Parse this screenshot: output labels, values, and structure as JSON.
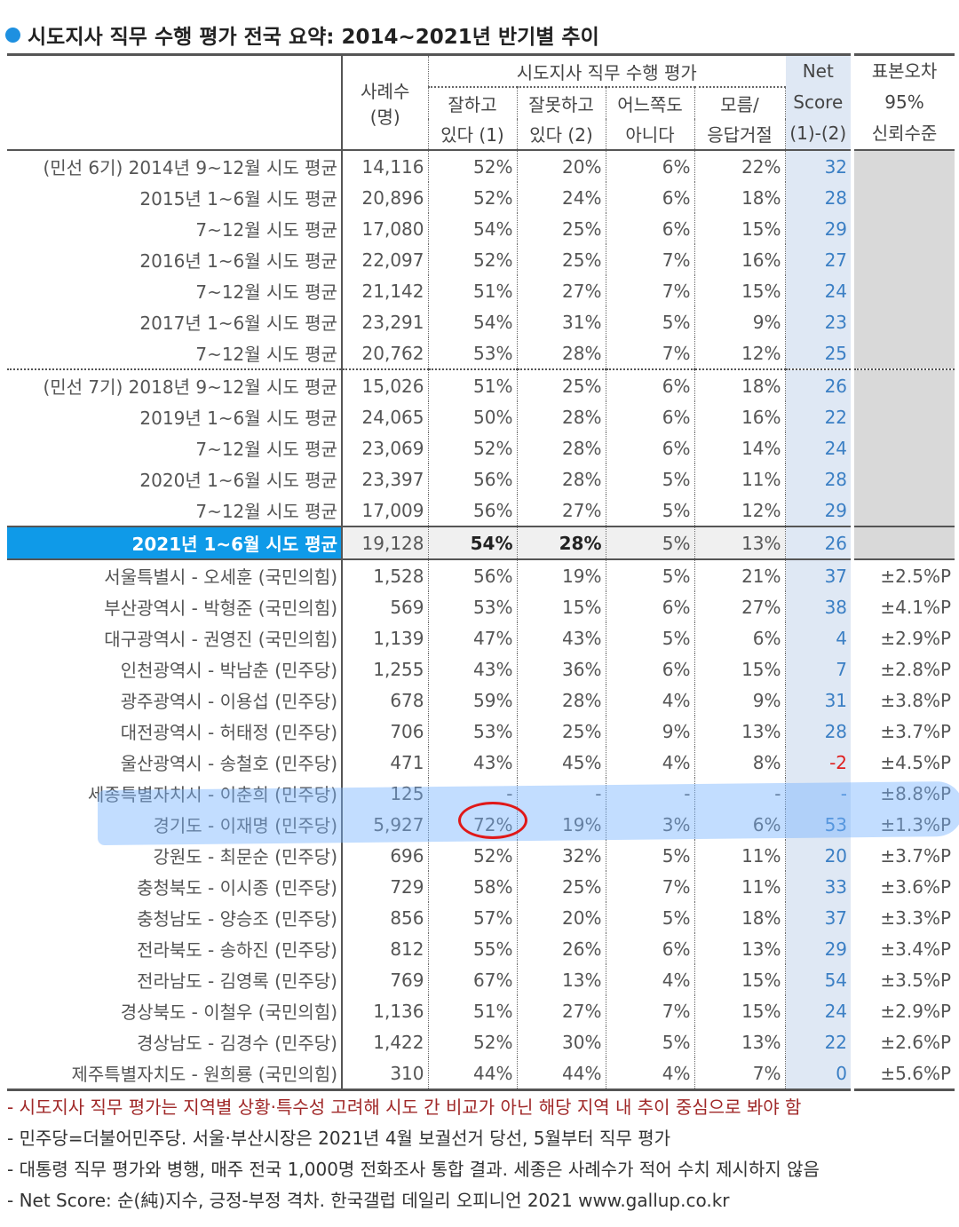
{
  "title": "시도지사 직무 수행 평가 전국 요약: 2014~2021년 반기별 추이",
  "header": {
    "cases": "사례수",
    "cases_unit": "(명)",
    "group": "시도지사 직무 수행 평가",
    "c1a": "잘하고",
    "c1b": "있다 (1)",
    "c2a": "잘못하고",
    "c2b": "있다 (2)",
    "c3a": "어느쪽도",
    "c3b": "아니다",
    "c4a": "모름/",
    "c4b": "응답거절",
    "neta": "Net",
    "netb": "Score",
    "netc": "(1)-(2)",
    "erra": "표본오차",
    "errb": "95%",
    "errc": "신뢰수준"
  },
  "rows": [
    [
      "(민선 6기) 2014년 9~12월 시도 평균",
      "14,116",
      "52%",
      "20%",
      "6%",
      "22%",
      "32",
      ""
    ],
    [
      "2015년 1~6월 시도 평균",
      "20,896",
      "52%",
      "24%",
      "6%",
      "18%",
      "28",
      ""
    ],
    [
      "7~12월 시도 평균",
      "17,080",
      "54%",
      "25%",
      "6%",
      "15%",
      "29",
      ""
    ],
    [
      "2016년 1~6월 시도 평균",
      "22,097",
      "52%",
      "25%",
      "7%",
      "16%",
      "27",
      ""
    ],
    [
      "7~12월 시도 평균",
      "21,142",
      "51%",
      "27%",
      "7%",
      "15%",
      "24",
      ""
    ],
    [
      "2017년 1~6월 시도 평균",
      "23,291",
      "54%",
      "31%",
      "5%",
      "9%",
      "23",
      ""
    ],
    [
      "7~12월 시도 평균",
      "20,762",
      "53%",
      "28%",
      "7%",
      "12%",
      "25",
      ""
    ],
    [
      "(민선 7기) 2018년 9~12월 시도 평균",
      "15,026",
      "51%",
      "25%",
      "6%",
      "18%",
      "26",
      ""
    ],
    [
      "2019년 1~6월 시도 평균",
      "24,065",
      "50%",
      "28%",
      "6%",
      "16%",
      "22",
      ""
    ],
    [
      "7~12월 시도 평균",
      "23,069",
      "52%",
      "28%",
      "6%",
      "14%",
      "24",
      ""
    ],
    [
      "2020년 1~6월 시도 평균",
      "23,397",
      "56%",
      "28%",
      "5%",
      "11%",
      "28",
      ""
    ],
    [
      "7~12월 시도 평균",
      "17,009",
      "56%",
      "27%",
      "5%",
      "12%",
      "29",
      ""
    ],
    [
      "2021년 1~6월 시도 평균",
      "19,128",
      "54%",
      "28%",
      "5%",
      "13%",
      "26",
      ""
    ],
    [
      "서울특별시 - 오세훈 (국민의힘)",
      "1,528",
      "56%",
      "19%",
      "5%",
      "21%",
      "37",
      "±2.5%P"
    ],
    [
      "부산광역시 - 박형준 (국민의힘)",
      "569",
      "53%",
      "15%",
      "6%",
      "27%",
      "38",
      "±4.1%P"
    ],
    [
      "대구광역시 - 권영진 (국민의힘)",
      "1,139",
      "47%",
      "43%",
      "5%",
      "6%",
      "4",
      "±2.9%P"
    ],
    [
      "인천광역시 - 박남춘 (민주당)",
      "1,255",
      "43%",
      "36%",
      "6%",
      "15%",
      "7",
      "±2.8%P"
    ],
    [
      "광주광역시 - 이용섭 (민주당)",
      "678",
      "59%",
      "28%",
      "4%",
      "9%",
      "31",
      "±3.8%P"
    ],
    [
      "대전광역시 - 허태정 (민주당)",
      "706",
      "53%",
      "25%",
      "9%",
      "13%",
      "28",
      "±3.7%P"
    ],
    [
      "울산광역시 - 송철호 (민주당)",
      "471",
      "43%",
      "45%",
      "4%",
      "8%",
      "-2",
      "±4.5%P"
    ],
    [
      "세종특별자치시 - 이춘희 (민주당)",
      "125",
      "-",
      "-",
      "-",
      "-",
      "-",
      "±8.8%P"
    ],
    [
      "경기도 - 이재명 (민주당)",
      "5,927",
      "72%",
      "19%",
      "3%",
      "6%",
      "53",
      "±1.3%P"
    ],
    [
      "강원도 - 최문순 (민주당)",
      "696",
      "52%",
      "32%",
      "5%",
      "11%",
      "20",
      "±3.7%P"
    ],
    [
      "충청북도 - 이시종 (민주당)",
      "729",
      "58%",
      "25%",
      "7%",
      "11%",
      "33",
      "±3.6%P"
    ],
    [
      "충청남도 - 양승조 (민주당)",
      "856",
      "57%",
      "20%",
      "5%",
      "18%",
      "37",
      "±3.3%P"
    ],
    [
      "전라북도 - 송하진 (민주당)",
      "812",
      "55%",
      "26%",
      "6%",
      "13%",
      "29",
      "±3.4%P"
    ],
    [
      "전라남도 - 김영록 (민주당)",
      "769",
      "67%",
      "13%",
      "4%",
      "15%",
      "54",
      "±3.5%P"
    ],
    [
      "경상북도 - 이철우 (국민의힘)",
      "1,136",
      "51%",
      "27%",
      "7%",
      "15%",
      "24",
      "±2.9%P"
    ],
    [
      "경상남도 - 김경수 (민주당)",
      "1,422",
      "52%",
      "30%",
      "5%",
      "13%",
      "22",
      "±2.6%P"
    ],
    [
      "제주특별자치도 - 원희룡 (국민의힘)",
      "310",
      "44%",
      "44%",
      "4%",
      "7%",
      "0",
      "±5.6%P"
    ]
  ],
  "notes": [
    "- 시도지사 직무 평가는 지역별 상황·특수성 고려해 시도 간 비교가 아닌 해당 지역 내 추이 중심으로 봐야 함",
    "- 민주당=더불어민주당. 서울·부산시장은 2021년 4월 보궐선거 당선, 5월부터 직무 평가",
    "- 대통령 직무 평가와 병행, 매주 전국 1,000명 전화조사 통합 결과. 세종은 사례수가 적어 수치 제시하지 않음",
    "- Net Score: 순(純)지수, 긍정-부정 격차. 한국갤럽 데일리 오피니언 2021 www.gallup.co.kr"
  ],
  "colors": {
    "accent": "#0f9ae8",
    "negative": "#e02020",
    "net": "#3b7fc4",
    "highlight": "#78b4ff",
    "circle": "#e01818"
  }
}
